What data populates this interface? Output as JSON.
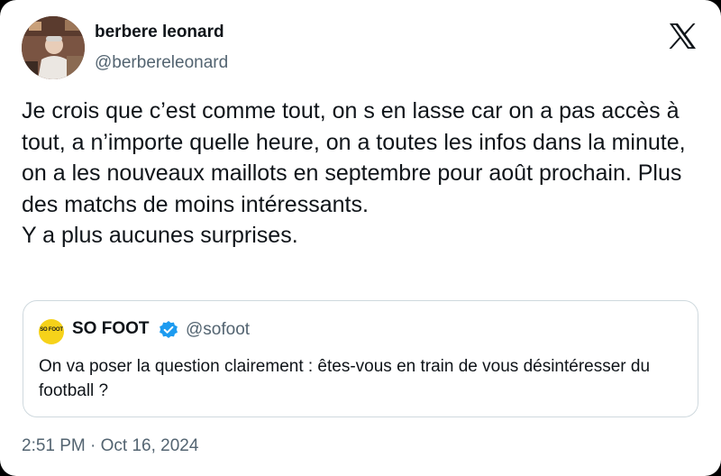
{
  "author": {
    "display_name": "berbere leonard",
    "handle": "@berbereleonard",
    "avatar_icon": "profile-photo"
  },
  "platform": {
    "logo_icon": "x-logo-icon"
  },
  "tweet": {
    "text": "Je crois que c’est comme tout, on s en lasse car on a pas accès à tout, a n’importe quelle heure, on a toutes les infos dans la minute, on a les nouveaux maillots en septembre pour août prochain. Plus des matchs de moins intéressants.\nY a plus aucunes surprises.",
    "timestamp": "2:51 PM · Oct 16, 2024"
  },
  "quoted_tweet": {
    "avatar_text": "SO FOOT",
    "display_name": "SO FOOT",
    "verified_icon": "verified-badge-icon",
    "handle": "@sofoot",
    "text": "On va poser la question clairement : êtes-vous en train de vous désintéresser du football ?"
  },
  "colors": {
    "background": "#ffffff",
    "text_primary": "#0f1419",
    "text_secondary": "#536471",
    "border": "#cfd9de",
    "verified": "#1d9bf0",
    "sofoot_yellow": "#f6d21a"
  }
}
